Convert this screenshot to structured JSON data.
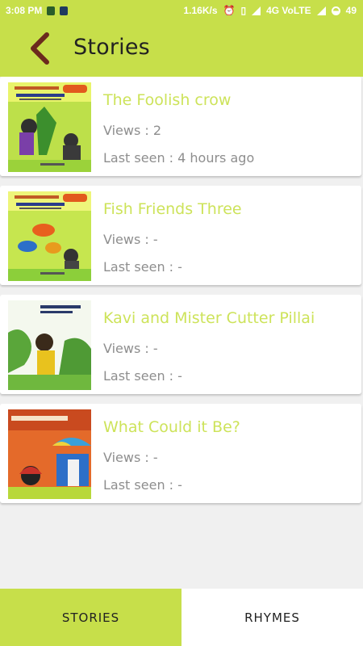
{
  "status_bar": {
    "time": "3:08 PM",
    "speed": "1.16K/s",
    "network": "4G VoLTE",
    "battery": "49"
  },
  "header": {
    "title": "Stories"
  },
  "stories": [
    {
      "title": "The Foolish crow",
      "views": "Views : 2",
      "last_seen": "Last seen : 4 hours ago"
    },
    {
      "title": "Fish Friends Three",
      "views": "Views : -",
      "last_seen": "Last seen : -"
    },
    {
      "title": "Kavi and Mister Cutter Pillai",
      "views": "Views : -",
      "last_seen": "Last seen : -"
    },
    {
      "title": "What Could it Be?",
      "views": "Views : -",
      "last_seen": "Last seen : -"
    }
  ],
  "tabs": [
    {
      "label": "STORIES",
      "active": true
    },
    {
      "label": "RHYMES",
      "active": false
    }
  ],
  "colors": {
    "accent": "#c7df4a",
    "title_text": "#cde35a",
    "meta_text": "#8e8e8e"
  }
}
